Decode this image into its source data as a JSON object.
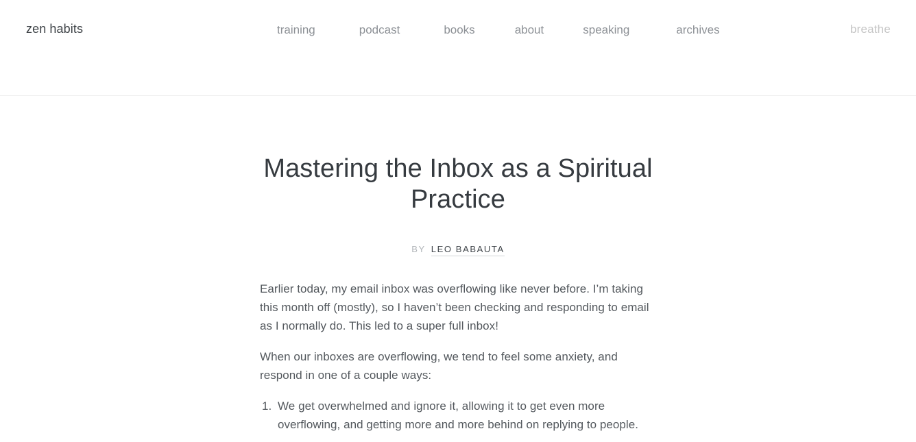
{
  "header": {
    "logo": "zen habits",
    "nav_items": [
      {
        "label": "training"
      },
      {
        "label": "podcast"
      },
      {
        "label": "books"
      },
      {
        "label": "about"
      },
      {
        "label": "speaking"
      },
      {
        "label": "archives"
      }
    ],
    "breathe_label": "breathe"
  },
  "article": {
    "title": "Mastering the Inbox as a Spiritual Practice",
    "byline_prefix": "BY",
    "byline_author": "LEO BABAUTA",
    "paragraphs": [
      "Earlier today, my email inbox was overflowing like never before. I’m taking this month off (mostly), so I haven’t been checking and responding to email as I normally do. This led to a super full inbox!",
      "When our inboxes are overflowing, we tend to feel some anxiety, and respond in one of a couple ways:"
    ],
    "list_items": [
      "We get overwhelmed and ignore it, allowing it to get even more overflowing, and getting more and more behind on replying to people."
    ]
  },
  "colors": {
    "background": "#ffffff",
    "logo_text": "#3d4246",
    "nav_text": "#8d9196",
    "breathe_text": "#c6c6c6",
    "title_text": "#363b40",
    "body_text": "#53585d",
    "byline_muted": "#b0b4b8",
    "divider": "#f0f0f0"
  }
}
